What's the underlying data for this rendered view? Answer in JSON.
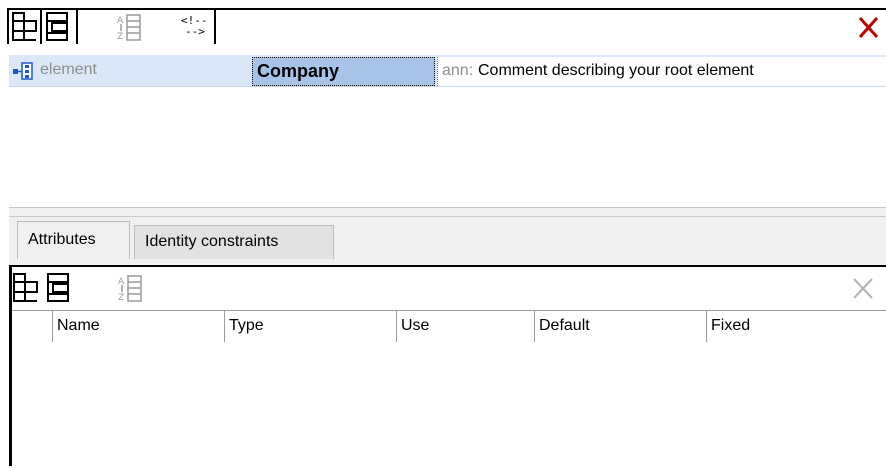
{
  "element_row": {
    "label": "element",
    "name": "Company",
    "annotation_prefix": "ann:",
    "annotation_text": "Comment describing your root element"
  },
  "tabs": [
    {
      "label": "Attributes"
    },
    {
      "label": "Identity constraints"
    }
  ],
  "attributes_grid": {
    "columns": [
      "Name",
      "Type",
      "Use",
      "Default",
      "Fixed"
    ]
  },
  "colors": {
    "selection_row": "#dbe8f7",
    "selected_cell": "#a7c4e8",
    "delete_active": "#c00000",
    "delete_disabled": "#b4b4b4"
  }
}
